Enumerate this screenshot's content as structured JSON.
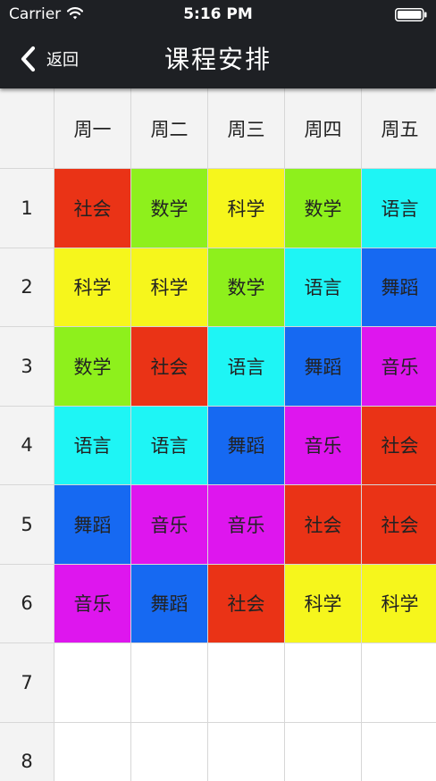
{
  "status_bar": {
    "carrier": "Carrier",
    "time": "5:16 PM"
  },
  "nav": {
    "back_label": "返回",
    "title": "课程安排"
  },
  "subject_colors": {
    "社会": "#ea3316",
    "数学": "#8ef01c",
    "科学": "#f6f61c",
    "语言": "#1ef5f5",
    "舞蹈": "#1669f2",
    "音乐": "#de16ee"
  },
  "timetable": {
    "days": [
      "周一",
      "周二",
      "周三",
      "周四",
      "周五"
    ],
    "periods": [
      "1",
      "2",
      "3",
      "4",
      "5",
      "6",
      "7",
      "8"
    ],
    "rows": [
      [
        "社会",
        "数学",
        "科学",
        "数学",
        "语言"
      ],
      [
        "科学",
        "科学",
        "数学",
        "语言",
        "舞蹈"
      ],
      [
        "数学",
        "社会",
        "语言",
        "舞蹈",
        "音乐"
      ],
      [
        "语言",
        "语言",
        "舞蹈",
        "音乐",
        "社会"
      ],
      [
        "舞蹈",
        "音乐",
        "音乐",
        "社会",
        "社会"
      ],
      [
        "音乐",
        "舞蹈",
        "社会",
        "科学",
        "科学"
      ],
      [
        "",
        "",
        "",
        "",
        ""
      ],
      [
        "",
        "",
        "",
        "",
        ""
      ]
    ]
  }
}
